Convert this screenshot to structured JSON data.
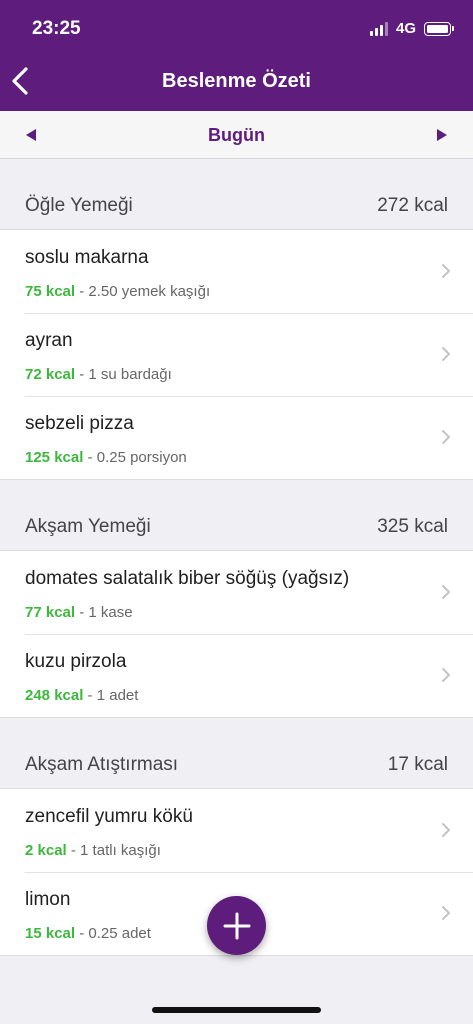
{
  "status": {
    "time": "23:25",
    "network": "4G"
  },
  "nav": {
    "title": "Beslenme Özeti",
    "back_icon": "chevron-left-icon"
  },
  "date": {
    "label": "Bugün",
    "prev_icon": "triangle-left-icon",
    "next_icon": "triangle-right-icon"
  },
  "sections": [
    {
      "title": "Öğle Yemeği",
      "calories": "272 kcal",
      "items": [
        {
          "name": "soslu makarna",
          "kcal": "75 kcal",
          "portion": " - 2.50 yemek kaşığı"
        },
        {
          "name": "ayran",
          "kcal": "72 kcal",
          "portion": " - 1 su bardağı"
        },
        {
          "name": "sebzeli pizza",
          "kcal": "125 kcal",
          "portion": " - 0.25 porsiyon"
        }
      ]
    },
    {
      "title": "Akşam Yemeği",
      "calories": "325 kcal",
      "items": [
        {
          "name": "domates salatalık biber söğüş (yağsız)",
          "kcal": "77 kcal",
          "portion": " - 1 kase"
        },
        {
          "name": "kuzu pirzola",
          "kcal": "248 kcal",
          "portion": " - 1 adet"
        }
      ]
    },
    {
      "title": "Akşam Atıştırması",
      "calories": "17 kcal",
      "items": [
        {
          "name": "zencefil yumru kökü",
          "kcal": "2 kcal",
          "portion": " - 1 tatlı kaşığı"
        },
        {
          "name": "limon",
          "kcal": "15 kcal",
          "portion": " - 0.25 adet"
        }
      ]
    }
  ],
  "fab": {
    "icon": "plus-icon"
  },
  "colors": {
    "brand": "#5e1d7c",
    "kcal": "#3db83d",
    "background": "#efeff4"
  }
}
